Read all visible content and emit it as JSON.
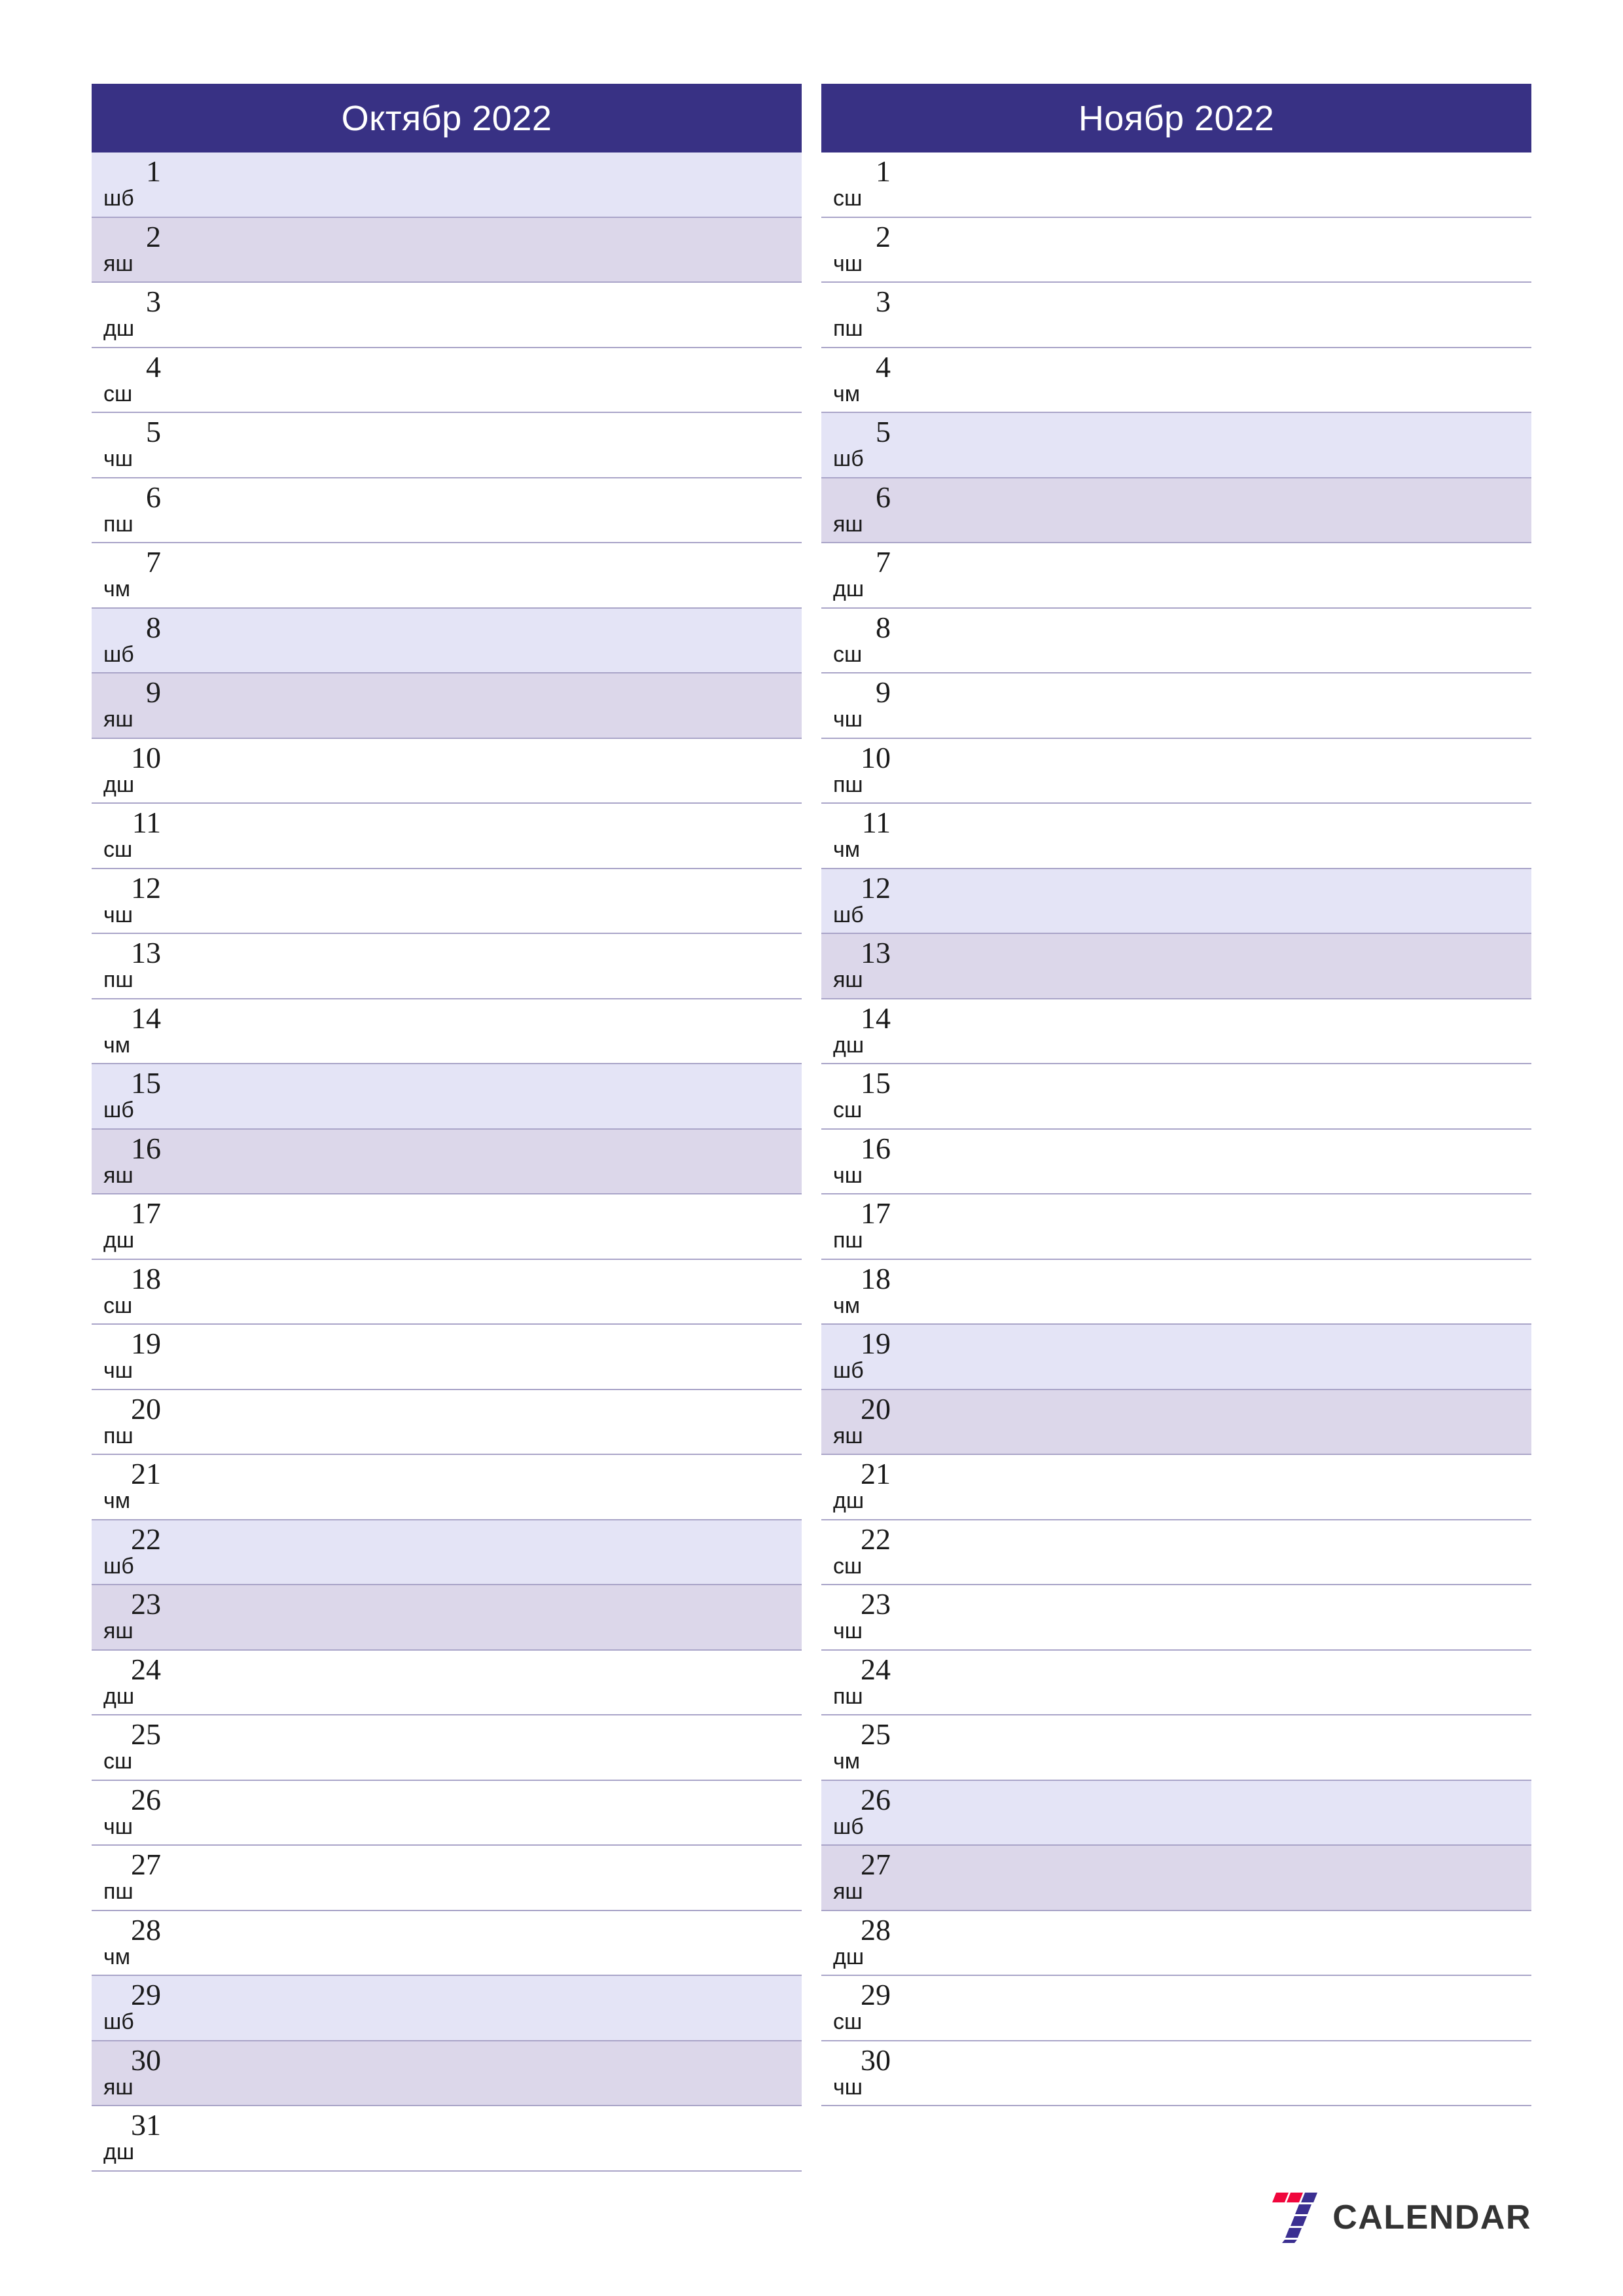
{
  "colors": {
    "header_bg": "#383184",
    "header_text": "#ffffff",
    "saturday_bg": "#e4e4f6",
    "sunday_bg": "#dcd7ea",
    "row_border": "#a9a4c8",
    "logo_red": "#f0063c",
    "logo_purple": "#3b2f91",
    "logo_word": "#333333"
  },
  "footer": {
    "logo_name": "seven-calendar-logo",
    "brand": "CALENDAR"
  },
  "months": [
    {
      "title": "Октябр 2022",
      "name": "october-2022",
      "days": [
        {
          "num": "1",
          "dow": "шб",
          "type": "sat"
        },
        {
          "num": "2",
          "dow": "яш",
          "type": "sun"
        },
        {
          "num": "3",
          "dow": "дш",
          "type": "weekday"
        },
        {
          "num": "4",
          "dow": "сш",
          "type": "weekday"
        },
        {
          "num": "5",
          "dow": "чш",
          "type": "weekday"
        },
        {
          "num": "6",
          "dow": "пш",
          "type": "weekday"
        },
        {
          "num": "7",
          "dow": "чм",
          "type": "weekday"
        },
        {
          "num": "8",
          "dow": "шб",
          "type": "sat"
        },
        {
          "num": "9",
          "dow": "яш",
          "type": "sun"
        },
        {
          "num": "10",
          "dow": "дш",
          "type": "weekday"
        },
        {
          "num": "11",
          "dow": "сш",
          "type": "weekday"
        },
        {
          "num": "12",
          "dow": "чш",
          "type": "weekday"
        },
        {
          "num": "13",
          "dow": "пш",
          "type": "weekday"
        },
        {
          "num": "14",
          "dow": "чм",
          "type": "weekday"
        },
        {
          "num": "15",
          "dow": "шб",
          "type": "sat"
        },
        {
          "num": "16",
          "dow": "яш",
          "type": "sun"
        },
        {
          "num": "17",
          "dow": "дш",
          "type": "weekday"
        },
        {
          "num": "18",
          "dow": "сш",
          "type": "weekday"
        },
        {
          "num": "19",
          "dow": "чш",
          "type": "weekday"
        },
        {
          "num": "20",
          "dow": "пш",
          "type": "weekday"
        },
        {
          "num": "21",
          "dow": "чм",
          "type": "weekday"
        },
        {
          "num": "22",
          "dow": "шб",
          "type": "sat"
        },
        {
          "num": "23",
          "dow": "яш",
          "type": "sun"
        },
        {
          "num": "24",
          "dow": "дш",
          "type": "weekday"
        },
        {
          "num": "25",
          "dow": "сш",
          "type": "weekday"
        },
        {
          "num": "26",
          "dow": "чш",
          "type": "weekday"
        },
        {
          "num": "27",
          "dow": "пш",
          "type": "weekday"
        },
        {
          "num": "28",
          "dow": "чм",
          "type": "weekday"
        },
        {
          "num": "29",
          "dow": "шб",
          "type": "sat"
        },
        {
          "num": "30",
          "dow": "яш",
          "type": "sun"
        },
        {
          "num": "31",
          "dow": "дш",
          "type": "weekday"
        }
      ]
    },
    {
      "title": "Ноябр 2022",
      "name": "november-2022",
      "days": [
        {
          "num": "1",
          "dow": "сш",
          "type": "weekday"
        },
        {
          "num": "2",
          "dow": "чш",
          "type": "weekday"
        },
        {
          "num": "3",
          "dow": "пш",
          "type": "weekday"
        },
        {
          "num": "4",
          "dow": "чм",
          "type": "weekday"
        },
        {
          "num": "5",
          "dow": "шб",
          "type": "sat"
        },
        {
          "num": "6",
          "dow": "яш",
          "type": "sun"
        },
        {
          "num": "7",
          "dow": "дш",
          "type": "weekday"
        },
        {
          "num": "8",
          "dow": "сш",
          "type": "weekday"
        },
        {
          "num": "9",
          "dow": "чш",
          "type": "weekday"
        },
        {
          "num": "10",
          "dow": "пш",
          "type": "weekday"
        },
        {
          "num": "11",
          "dow": "чм",
          "type": "weekday"
        },
        {
          "num": "12",
          "dow": "шб",
          "type": "sat"
        },
        {
          "num": "13",
          "dow": "яш",
          "type": "sun"
        },
        {
          "num": "14",
          "dow": "дш",
          "type": "weekday"
        },
        {
          "num": "15",
          "dow": "сш",
          "type": "weekday"
        },
        {
          "num": "16",
          "dow": "чш",
          "type": "weekday"
        },
        {
          "num": "17",
          "dow": "пш",
          "type": "weekday"
        },
        {
          "num": "18",
          "dow": "чм",
          "type": "weekday"
        },
        {
          "num": "19",
          "dow": "шб",
          "type": "sat"
        },
        {
          "num": "20",
          "dow": "яш",
          "type": "sun"
        },
        {
          "num": "21",
          "dow": "дш",
          "type": "weekday"
        },
        {
          "num": "22",
          "dow": "сш",
          "type": "weekday"
        },
        {
          "num": "23",
          "dow": "чш",
          "type": "weekday"
        },
        {
          "num": "24",
          "dow": "пш",
          "type": "weekday"
        },
        {
          "num": "25",
          "dow": "чм",
          "type": "weekday"
        },
        {
          "num": "26",
          "dow": "шб",
          "type": "sat"
        },
        {
          "num": "27",
          "dow": "яш",
          "type": "sun"
        },
        {
          "num": "28",
          "dow": "дш",
          "type": "weekday"
        },
        {
          "num": "29",
          "dow": "сш",
          "type": "weekday"
        },
        {
          "num": "30",
          "dow": "чш",
          "type": "weekday"
        }
      ]
    }
  ]
}
